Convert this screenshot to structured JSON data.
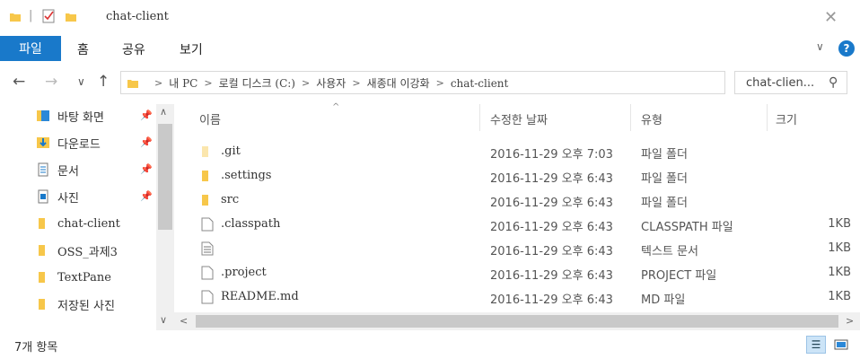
{
  "window": {
    "title": "chat-client",
    "close_glyph": "✕"
  },
  "ribbon": {
    "tabs": [
      {
        "label": "파일"
      },
      {
        "label": "홈"
      },
      {
        "label": "공유"
      },
      {
        "label": "보기"
      }
    ],
    "collapse_glyph": "∨",
    "help_glyph": "?"
  },
  "nav": {
    "back_glyph": "←",
    "forward_glyph": "→",
    "recent_glyph": "∨",
    "up_glyph": "↑"
  },
  "address": {
    "crumbs": [
      "내 PC",
      "로컬 디스크 (C:)",
      "사용자",
      "새종대 이강화",
      "chat-client"
    ],
    "separator": ">",
    "dropdown_glyph": "∨",
    "refresh_glyph": "↻"
  },
  "search": {
    "placeholder": "chat-clien...",
    "icon": "search-icon",
    "glyph": "⚲"
  },
  "sidebar": {
    "items": [
      {
        "label": "바탕 화면",
        "pinned": true,
        "icon": "desktop-icon"
      },
      {
        "label": "다운로드",
        "pinned": true,
        "icon": "download-icon"
      },
      {
        "label": "문서",
        "pinned": true,
        "icon": "document-icon"
      },
      {
        "label": "사진",
        "pinned": true,
        "icon": "picture-icon"
      },
      {
        "label": "chat-client",
        "pinned": false,
        "icon": "folder-icon"
      },
      {
        "label": "OSS_과제3",
        "pinned": false,
        "icon": "folder-icon"
      },
      {
        "label": "TextPane",
        "pinned": false,
        "icon": "folder-icon"
      },
      {
        "label": "저장된 사진",
        "pinned": false,
        "icon": "folder-icon"
      }
    ],
    "pin_glyph": "📌"
  },
  "filelist": {
    "columns": {
      "name": "이름",
      "modified": "수정한 날짜",
      "type": "유형",
      "size": "크기"
    },
    "sort_glyph": "^",
    "rows": [
      {
        "name": ".git",
        "modified": "2016-11-29 오후 7:03",
        "type": "파일 폴더",
        "size": "",
        "kind": "folder-faded"
      },
      {
        "name": ".settings",
        "modified": "2016-11-29 오후 6:43",
        "type": "파일 폴더",
        "size": "",
        "kind": "folder"
      },
      {
        "name": "src",
        "modified": "2016-11-29 오후 6:43",
        "type": "파일 폴더",
        "size": "",
        "kind": "folder"
      },
      {
        "name": ".classpath",
        "modified": "2016-11-29 오후 6:43",
        "type": "CLASSPATH 파일",
        "size": "1KB",
        "kind": "file"
      },
      {
        "name": "",
        "modified": "2016-11-29 오후 6:43",
        "type": "텍스트 문서",
        "size": "1KB",
        "kind": "text"
      },
      {
        "name": ".project",
        "modified": "2016-11-29 오후 6:43",
        "type": "PROJECT 파일",
        "size": "1KB",
        "kind": "file"
      },
      {
        "name": "README.md",
        "modified": "2016-11-29 오후 6:43",
        "type": "MD 파일",
        "size": "1KB",
        "kind": "file"
      }
    ]
  },
  "status": {
    "count_text": "7개 항목"
  },
  "colors": {
    "accent": "#1979ca",
    "folder": "#f7c74a"
  }
}
